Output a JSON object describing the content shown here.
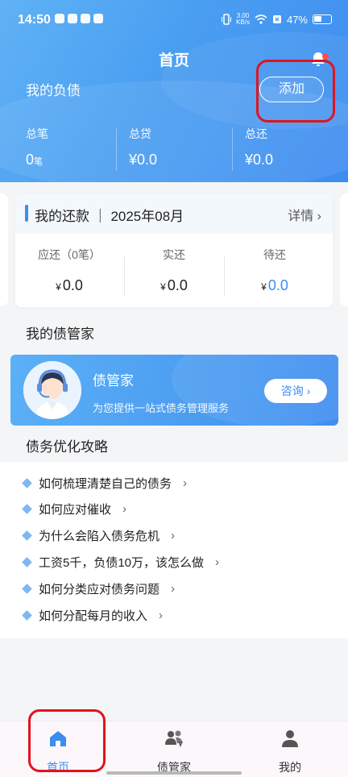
{
  "status_bar": {
    "time": "14:50",
    "network_speed": "3.00\nKB/s",
    "battery": "47%"
  },
  "header": {
    "title": "首页",
    "debt_label": "我的负债",
    "add_button": "添加",
    "stats": [
      {
        "label": "总笔",
        "value": "0",
        "unit": "笔"
      },
      {
        "label": "总贷",
        "value": "¥0.0",
        "unit": ""
      },
      {
        "label": "总还",
        "value": "¥0.0",
        "unit": ""
      }
    ]
  },
  "repayment": {
    "title": "我的还款 ｜ 2025年08月",
    "detail": "详情",
    "columns": [
      {
        "label": "应还（0笔）",
        "currency": "¥",
        "value": "0.0",
        "highlight": false
      },
      {
        "label": "实还",
        "currency": "¥",
        "value": "0.0",
        "highlight": false
      },
      {
        "label": "待还",
        "currency": "¥",
        "value": "0.0",
        "highlight": true
      }
    ]
  },
  "butler_section": {
    "title": "我的债管家",
    "card_name": "债管家",
    "card_desc": "为您提供一站式债务管理服务",
    "consult_button": "咨询"
  },
  "tips_section": {
    "title": "债务优化攻略",
    "items": [
      "如何梳理清楚自己的债务",
      "如何应对催收",
      "为什么会陷入债务危机",
      "工资5千，负债10万，该怎么做",
      "如何分类应对债务问题",
      "如何分配每月的收入"
    ]
  },
  "tabbar": {
    "tabs": [
      {
        "label": "首页",
        "icon": "home-icon",
        "active": true
      },
      {
        "label": "债管家",
        "icon": "users-icon",
        "active": false
      },
      {
        "label": "我的",
        "icon": "person-icon",
        "active": false
      }
    ]
  },
  "colors": {
    "accent": "#3d8cf0",
    "highlight_box": "#e0141e"
  }
}
